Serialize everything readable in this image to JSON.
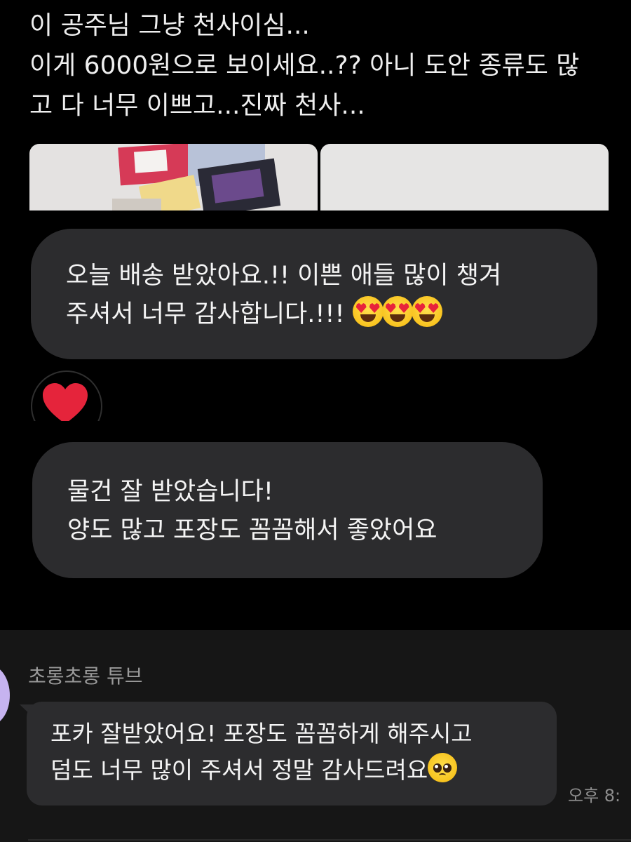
{
  "tweet": {
    "lines": [
      "이 공주님 그냥 천사이심...",
      "이게 6000원으로 보이세요..?? 아니 도안 종류도 많",
      "고 다 너무 이쁘고...진짜 천사..."
    ]
  },
  "messages": [
    {
      "lines": [
        "오늘 배송 받았아요.!! 이쁜 애들 많이 챙겨",
        "주셔서 너무 감사합니다.!!!"
      ],
      "emoji": "smiling-face-with-heart-eyes",
      "emoji_count": 3
    },
    {
      "lines": [
        "물건 잘 받았습니다!",
        "양도 많고 포장도 꼼꼼해서 좋았어요"
      ]
    }
  ],
  "reaction": {
    "icon": "heart-icon",
    "color": "#e5243b"
  },
  "chat": {
    "sender_name": "초롱초롱 튜브",
    "lines": [
      "포카 잘받았어요! 포장도 꼼꼼하게 해주시고",
      "덤도 너무 많이 주셔서 정말 감사드려요"
    ],
    "emoji": "pleading-face",
    "timestamp": "오후 8:"
  },
  "colors": {
    "background": "#000000",
    "bubble": "#2c2c2e",
    "lower_panel": "#161616",
    "avatar": "#c6b3f0"
  }
}
